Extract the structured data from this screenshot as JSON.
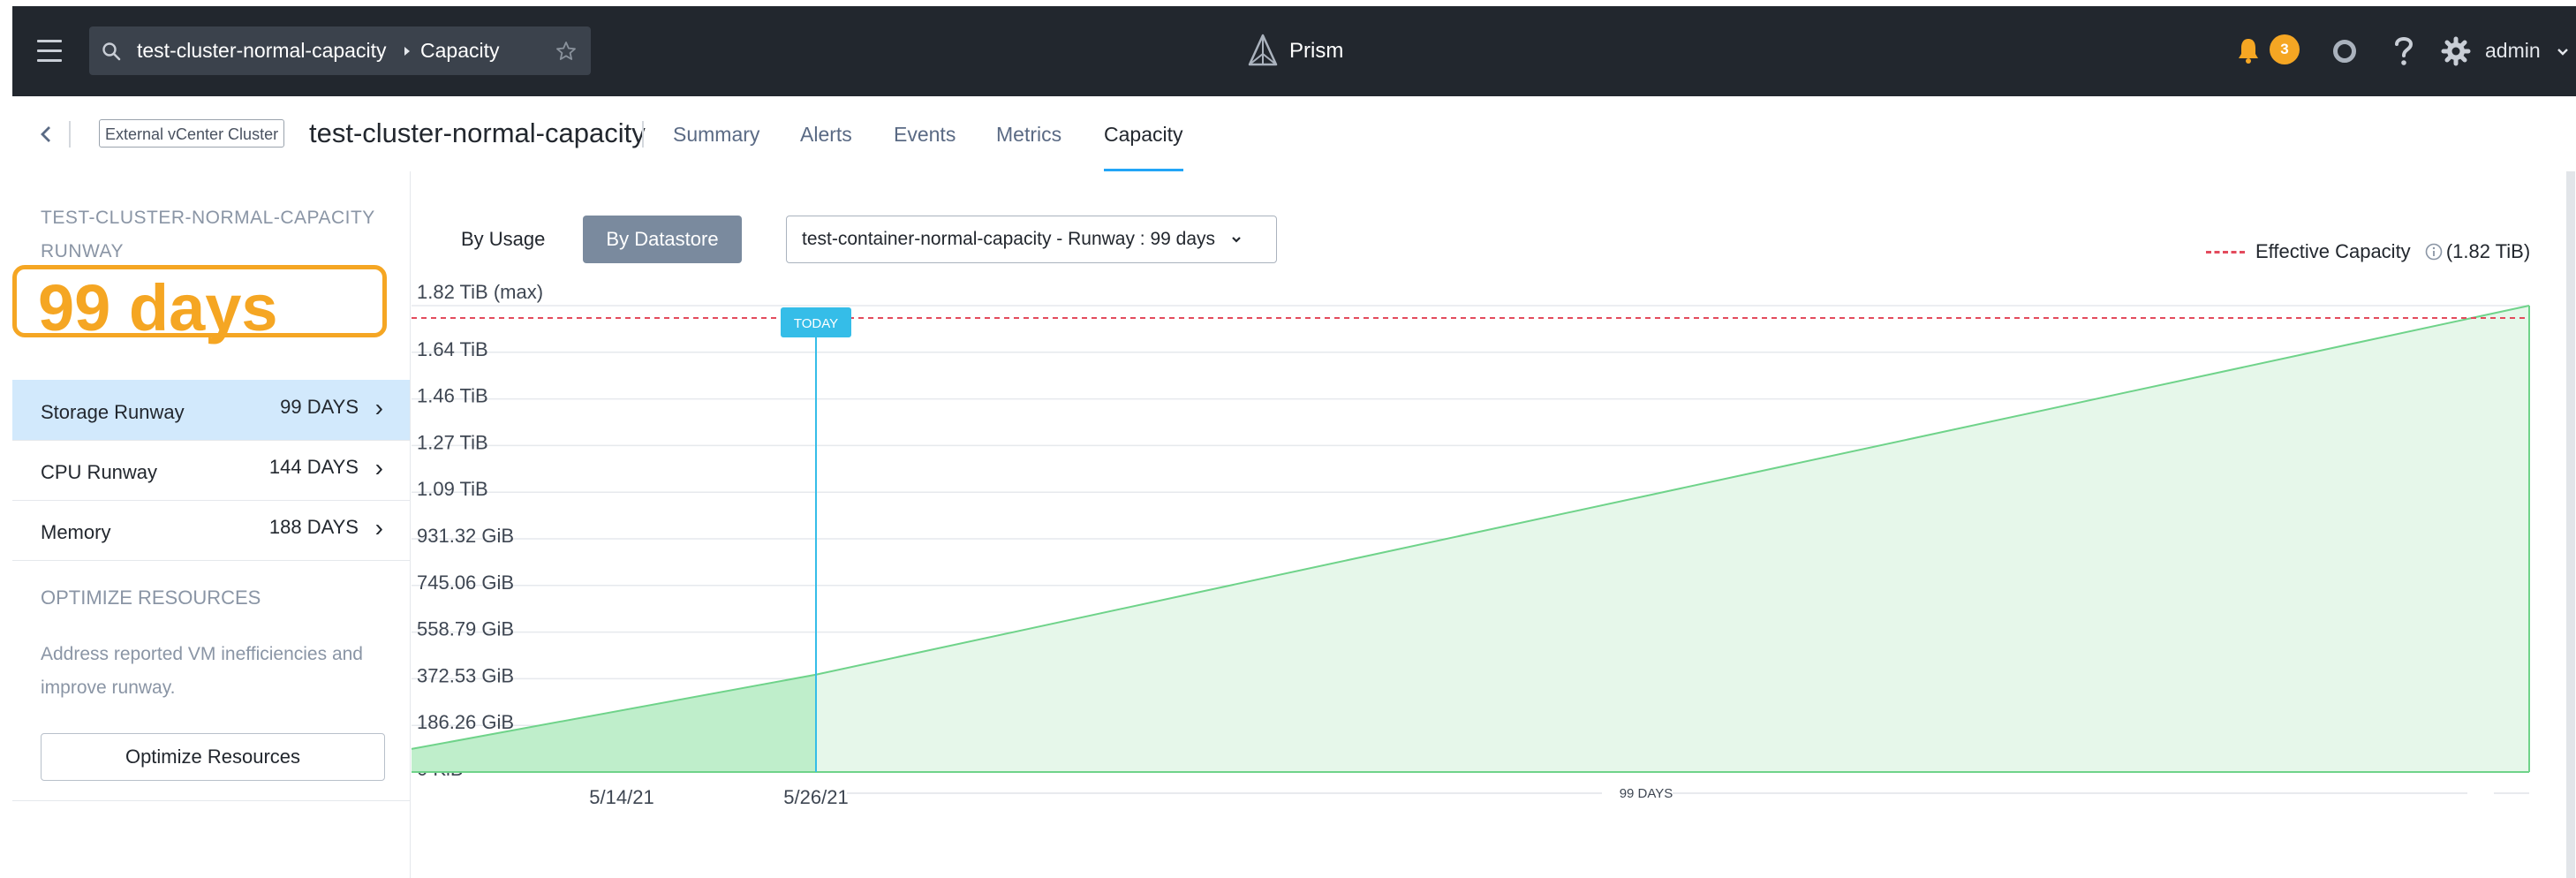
{
  "header": {
    "breadcrumb_cluster": "test-cluster-normal-capacity",
    "breadcrumb_page": "Capacity",
    "app_name": "Prism",
    "notification_count": "3",
    "user": "admin"
  },
  "subheader": {
    "entity_type": "External vCenter Cluster",
    "cluster_name": "test-cluster-normal-capacity",
    "tabs": [
      {
        "label": "Summary"
      },
      {
        "label": "Alerts"
      },
      {
        "label": "Events"
      },
      {
        "label": "Metrics"
      },
      {
        "label": "Capacity",
        "active": true
      }
    ]
  },
  "sidebar": {
    "heading": "TEST-CLUSTER-NORMAL-CAPACITY RUNWAY",
    "runway_value": "99 days",
    "items": [
      {
        "label": "Storage Runway",
        "value": "99 DAYS",
        "selected": true
      },
      {
        "label": "CPU Runway",
        "value": "144 DAYS"
      },
      {
        "label": "Memory",
        "value": "188 DAYS"
      }
    ],
    "optimize_heading": "OPTIMIZE RESOURCES",
    "optimize_desc": "Address reported VM inefficiencies and improve runway.",
    "optimize_button": "Optimize Resources"
  },
  "toolbar": {
    "by_usage": "By Usage",
    "by_datastore": "By Datastore",
    "container_select": "test-container-normal-capacity - Runway : 99 days",
    "legend_label": "Effective Capacity",
    "legend_value": "(1.82 TiB)"
  },
  "colors": {
    "accent": "#22a5f7",
    "runway_highlight": "#f5a623",
    "area_fill": "#bfeecb",
    "area_line": "#6fd38a",
    "capacity_line": "#e34b5d"
  },
  "chart_data": {
    "type": "area",
    "y_tick_labels": [
      "0 KiB",
      "186.26 GiB",
      "372.53 GiB",
      "558.79 GiB",
      "745.06 GiB",
      "931.32 GiB",
      "1.09 TiB",
      "1.27 TiB",
      "1.46 TiB",
      "1.64 TiB",
      "1.82 TiB (max)"
    ],
    "y_max_tib": 1.82,
    "x_tick_labels": [
      "5/14/21",
      "5/26/21"
    ],
    "today_label": "TODAY",
    "runway_label": "99 DAYS",
    "historical": {
      "start_tib": 0.09,
      "end_tib": 0.38
    },
    "forecast": {
      "start_tib": 0.38,
      "end_tib": 1.82
    },
    "effective_capacity_tib": 1.82
  }
}
